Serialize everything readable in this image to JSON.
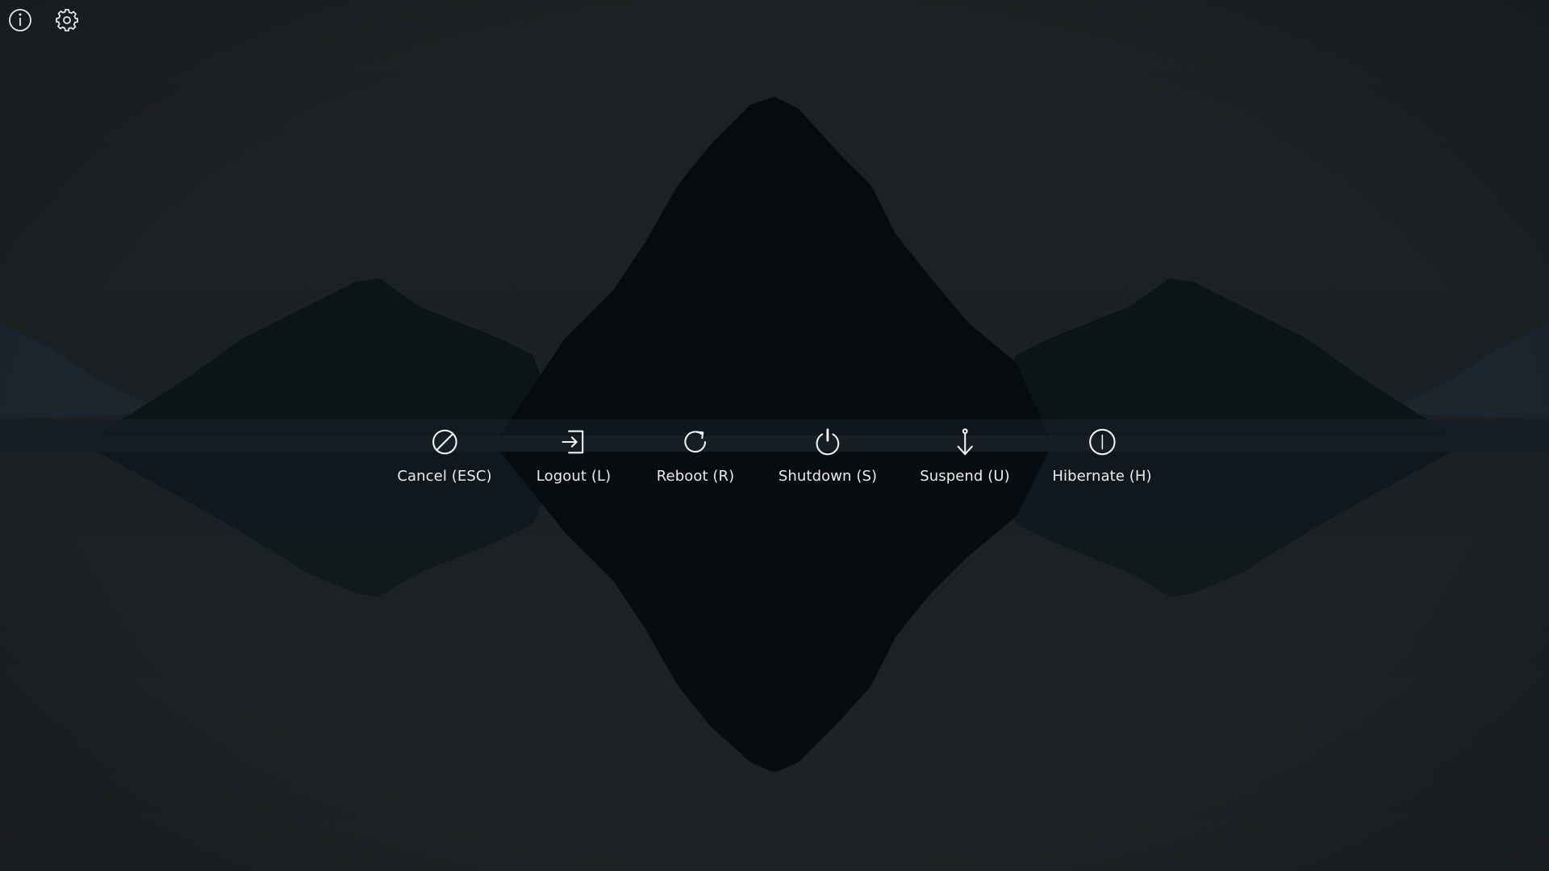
{
  "top_bar": {
    "info_icon": "info-icon",
    "settings_icon": "gear-icon"
  },
  "actions": [
    {
      "id": "cancel",
      "label": "Cancel (ESC)",
      "icon": "cancel-icon"
    },
    {
      "id": "logout",
      "label": "Logout (L)",
      "icon": "logout-icon"
    },
    {
      "id": "reboot",
      "label": "Reboot (R)",
      "icon": "reboot-icon"
    },
    {
      "id": "shutdown",
      "label": "Shutdown (S)",
      "icon": "power-icon"
    },
    {
      "id": "suspend",
      "label": "Suspend (U)",
      "icon": "anchor-icon"
    },
    {
      "id": "hibernate",
      "label": "Hibernate (H)",
      "icon": "hibernate-icon"
    }
  ],
  "colors": {
    "text": "#ececec",
    "background": "#1b2023"
  }
}
